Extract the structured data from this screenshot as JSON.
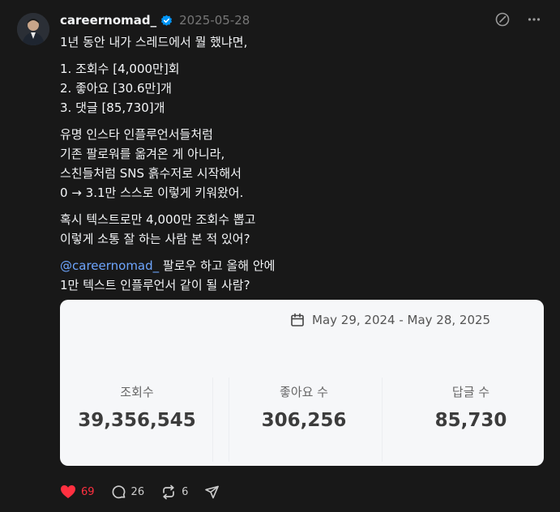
{
  "post": {
    "username": "careernomad_",
    "date": "2025-05-28",
    "paragraphs": [
      [
        "1년 동안 내가 스레드에서 뭘 했냐면,"
      ],
      [
        "1. 조회수 [4,000만]회",
        "2. 좋아요 [30.6만]개",
        "3. 댓글 [85,730]개"
      ],
      [
        "유명 인스타 인플루언서들처럼",
        "기존 팔로워를 옮겨온 게 아니라,",
        "스친들처럼 SNS 흙수저로 시작해서",
        "0 → 3.1만 스스로 이렇게 키워왔어."
      ],
      [
        "혹시 텍스트로만 4,000만 조회수 뽑고",
        "이렇게 소통 잘 하는 사람 본 적 있어?"
      ]
    ],
    "mention": "@careernomad_",
    "mention_rest": " 팔로우 하고 올해 안에",
    "last_line": "1만 텍스트 인플루언서 같이 될 사람?"
  },
  "card": {
    "date_range": "May 29, 2024 - May 28, 2025",
    "stats": [
      {
        "label": "조회수",
        "value": "39,356,545"
      },
      {
        "label": "좋아요 수",
        "value": "306,256"
      },
      {
        "label": "답글 수",
        "value": "85,730"
      }
    ]
  },
  "actions": {
    "likes": "69",
    "replies": "26",
    "reposts": "6"
  },
  "icons": {
    "verified": "verified-badge-icon",
    "header_action": "edit-icon",
    "more": "more-icon",
    "calendar": "calendar-icon",
    "like": "heart-icon",
    "reply": "comment-icon",
    "repost": "repost-icon",
    "share": "send-icon"
  },
  "colors": {
    "background": "#181818",
    "text": "#f3f5f7",
    "muted": "#777777",
    "mention": "#6ea6ff",
    "like": "#ff3040",
    "verified": "#0095f6",
    "card": "#f6f7f9"
  }
}
